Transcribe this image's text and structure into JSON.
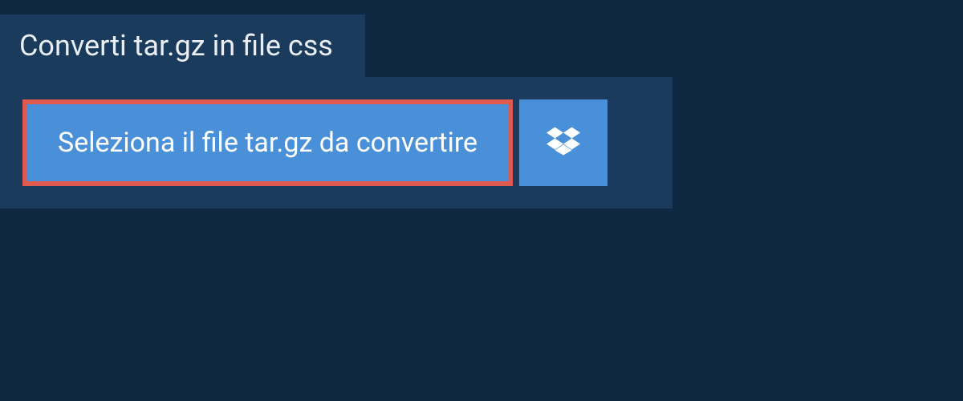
{
  "tab": {
    "title": "Converti tar.gz in file css"
  },
  "upload": {
    "select_file_label": "Seleziona il file tar.gz da convertire"
  },
  "colors": {
    "background": "#0d2840",
    "panel": "#1a3b5c",
    "button": "#4a90d9",
    "highlight_border": "#e05a52",
    "text_light": "#e8eef3",
    "text_white": "#ffffff"
  }
}
